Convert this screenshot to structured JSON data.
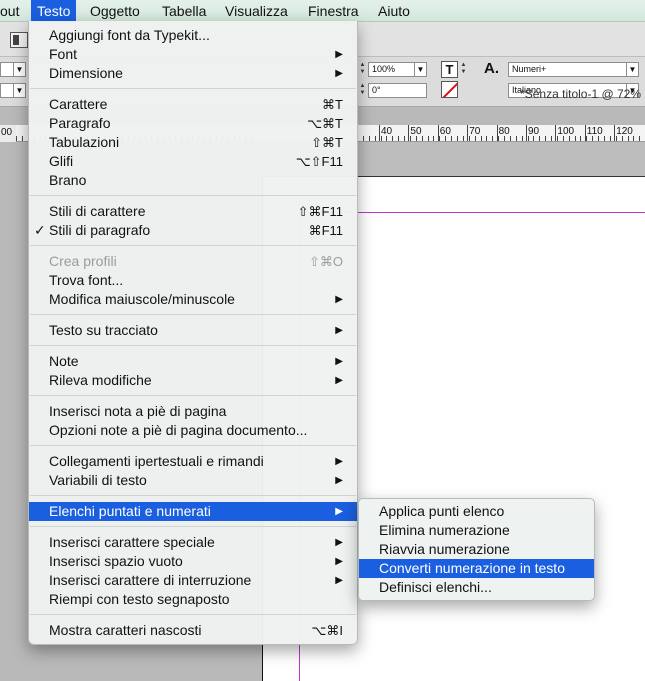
{
  "menubar": {
    "items": [
      "out",
      "Testo",
      "Oggetto",
      "Tabella",
      "Visualizza",
      "Finestra",
      "Aiuto"
    ],
    "active_index": 1
  },
  "control_panel": {
    "scale_value": "100%",
    "angle_value": "0°",
    "font_style": "Numeri+",
    "language": "Italiano",
    "type_icon": "T",
    "char_style_icon": "A."
  },
  "document": {
    "title": "*Senza titolo-1 @ 72%"
  },
  "ruler": {
    "left_label": "00",
    "labels": [
      "40",
      "50",
      "60",
      "70",
      "80",
      "90",
      "100",
      "110",
      "120"
    ]
  },
  "menu": {
    "items": [
      {
        "label": "Aggiungi font da Typekit...",
        "shortcut": "",
        "submenu": false
      },
      {
        "label": "Font",
        "shortcut": "",
        "submenu": true
      },
      {
        "label": "Dimensione",
        "shortcut": "",
        "submenu": true
      },
      {
        "label": "Carattere",
        "shortcut": "⌘T",
        "submenu": false
      },
      {
        "label": "Paragrafo",
        "shortcut": "⌥⌘T",
        "submenu": false
      },
      {
        "label": "Tabulazioni",
        "shortcut": "⇧⌘T",
        "submenu": false
      },
      {
        "label": "Glifi",
        "shortcut": "⌥⇧F11",
        "submenu": false
      },
      {
        "label": "Brano",
        "shortcut": "",
        "submenu": false
      },
      {
        "label": "Stili di carattere",
        "shortcut": "⇧⌘F11",
        "submenu": false
      },
      {
        "label": "Stili di paragrafo",
        "shortcut": "⌘F11",
        "submenu": false,
        "checked": true
      },
      {
        "label": "Crea profili",
        "shortcut": "⇧⌘O",
        "submenu": false,
        "disabled": true
      },
      {
        "label": "Trova font...",
        "shortcut": "",
        "submenu": false
      },
      {
        "label": "Modifica maiuscole/minuscole",
        "shortcut": "",
        "submenu": true
      },
      {
        "label": "Testo su tracciato",
        "shortcut": "",
        "submenu": true
      },
      {
        "label": "Note",
        "shortcut": "",
        "submenu": true
      },
      {
        "label": "Rileva modifiche",
        "shortcut": "",
        "submenu": true
      },
      {
        "label": "Inserisci nota a piè di pagina",
        "shortcut": "",
        "submenu": false
      },
      {
        "label": "Opzioni note a piè di pagina documento...",
        "shortcut": "",
        "submenu": false
      },
      {
        "label": "Collegamenti ipertestuali e rimandi",
        "shortcut": "",
        "submenu": true
      },
      {
        "label": "Variabili di testo",
        "shortcut": "",
        "submenu": true
      },
      {
        "label": "Elenchi puntati e numerati",
        "shortcut": "",
        "submenu": true,
        "highlighted": true
      },
      {
        "label": "Inserisci carattere speciale",
        "shortcut": "",
        "submenu": true
      },
      {
        "label": "Inserisci spazio vuoto",
        "shortcut": "",
        "submenu": true
      },
      {
        "label": "Inserisci carattere di interruzione",
        "shortcut": "",
        "submenu": true
      },
      {
        "label": "Riempi con testo segnaposto",
        "shortcut": "",
        "submenu": false
      },
      {
        "label": "Mostra caratteri nascosti",
        "shortcut": "⌥⌘I",
        "submenu": false
      }
    ]
  },
  "submenu": {
    "items": [
      {
        "label": "Applica punti elenco"
      },
      {
        "label": "Elimina numerazione"
      },
      {
        "label": "Riavvia numerazione"
      },
      {
        "label": "Converti numerazione in testo",
        "highlighted": true
      },
      {
        "label": "Definisci elenchi..."
      }
    ]
  },
  "colors": {
    "highlight": "#1a5fe0",
    "margin_guide": "#c037c7",
    "menubar_bg": "#d8ebe1"
  }
}
